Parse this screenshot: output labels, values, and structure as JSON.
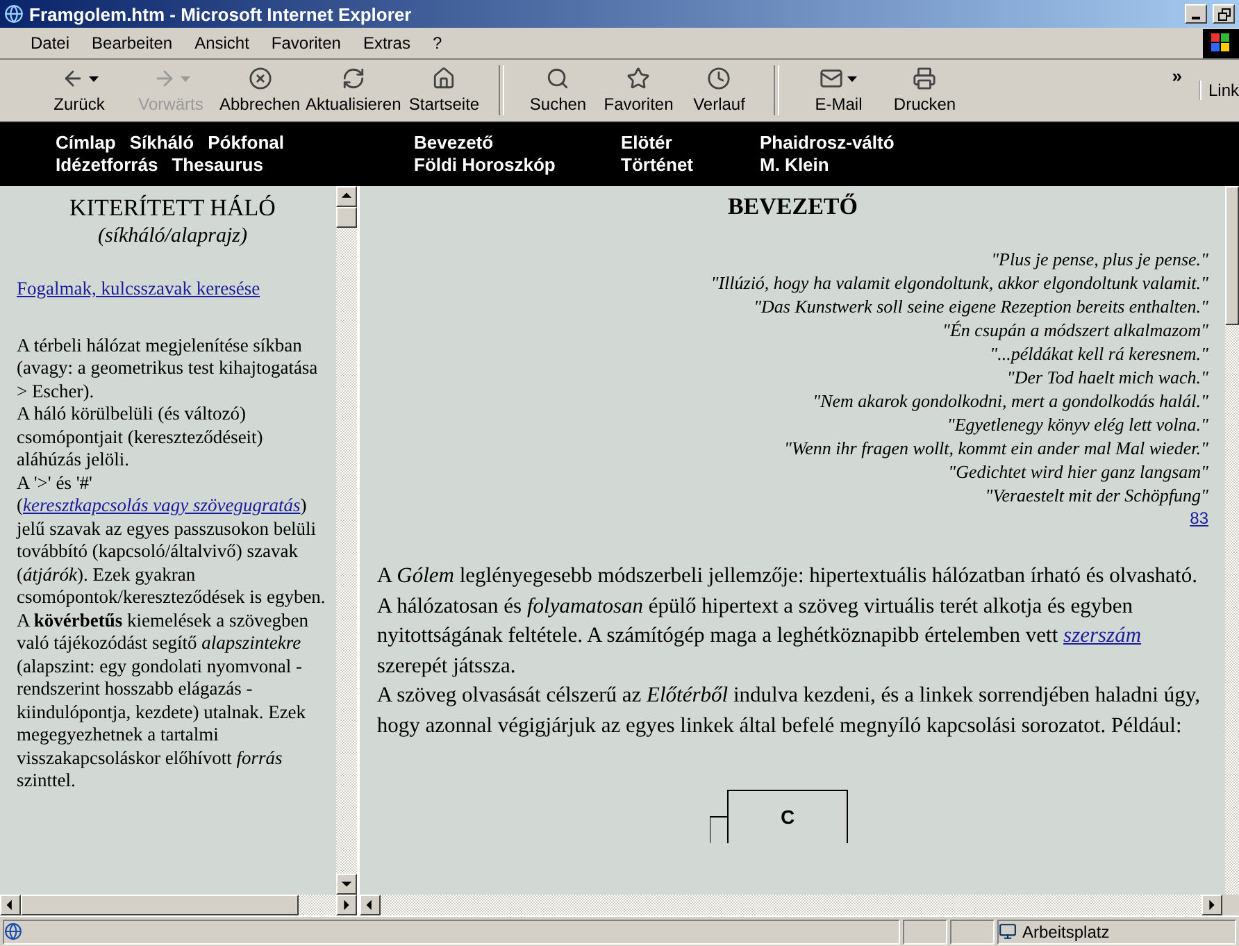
{
  "window": {
    "title": "Framgolem.htm - Microsoft Internet Explorer"
  },
  "menu": [
    "Datei",
    "Bearbeiten",
    "Ansicht",
    "Favoriten",
    "Extras",
    "?"
  ],
  "toolbar": [
    {
      "label": "Zurück",
      "kind": "back",
      "dropdown": true,
      "disabled": false
    },
    {
      "label": "Vorwärts",
      "kind": "forward",
      "dropdown": true,
      "disabled": true
    },
    {
      "label": "Abbrechen",
      "kind": "stop",
      "dropdown": false,
      "disabled": false
    },
    {
      "label": "Aktualisieren",
      "kind": "refresh",
      "dropdown": false,
      "disabled": false
    },
    {
      "label": "Startseite",
      "kind": "home",
      "dropdown": false,
      "disabled": false,
      "separator_after": true
    },
    {
      "label": "Suchen",
      "kind": "search",
      "dropdown": false,
      "disabled": false
    },
    {
      "label": "Favoriten",
      "kind": "favorites",
      "dropdown": false,
      "disabled": false
    },
    {
      "label": "Verlauf",
      "kind": "history",
      "dropdown": false,
      "disabled": false,
      "separator_after": true
    },
    {
      "label": "E-Mail",
      "kind": "mail",
      "dropdown": true,
      "disabled": false
    },
    {
      "label": "Drucken",
      "kind": "print",
      "dropdown": false,
      "disabled": false
    }
  ],
  "toolbar_more": "»",
  "links_label": "Link",
  "nav": [
    {
      "rows": [
        [
          "Címlap",
          "Síkháló",
          "Pókfonal"
        ],
        [
          "Idézetforrás",
          "Thesaurus"
        ]
      ]
    },
    {
      "rows": [
        [
          "Bevezető"
        ],
        [
          "Földi Horoszkóp"
        ]
      ]
    },
    {
      "rows": [
        [
          "Elötér"
        ],
        [
          "Történet"
        ]
      ]
    },
    {
      "rows": [
        [
          "Phaidrosz-váltó"
        ],
        [
          "M. Klein"
        ]
      ]
    }
  ],
  "left_frame": {
    "title": "KITERÍTETT HÁLÓ",
    "subtitle": "(síkháló/alaprajz)",
    "search_link": "Fogalmak, kulcsszavak keresése",
    "paragraphs": [
      [
        {
          "kind": "text",
          "text": "A térbeli hálózat megjelenítése síkban (avagy: a geometrikus test kihajtogatása > Escher)."
        }
      ],
      [
        {
          "kind": "text",
          "text": "A háló körülbelüli (és változó) csomópontjait (kereszteződéseit) aláhúzás jelöli."
        }
      ],
      [
        {
          "kind": "text",
          "text": "A '>' és '#' ("
        },
        {
          "kind": "link",
          "text": "keresztkapcsolás vagy szövegugratás"
        },
        {
          "kind": "text",
          "text": ") jelű szavak az egyes passzusokon belüli továbbító (kapcsoló/általvivő) szavak (*átjárók*). Ezek gyakran csomópontok/kereszteződések is egyben."
        }
      ],
      [
        {
          "kind": "text",
          "text": "A **kövérbetűs** kiemelések a szövegben való tájékozódást segítő *alapszintekre* (alapszint: egy gondolati nyomvonal - rendszerint hosszabb elágazás - kiindulópontja, kezdete) utalnak. Ezek megegyezhetnek a tartalmi visszakapcsoláskor előhívott *forrás* szinttel."
        }
      ]
    ]
  },
  "main_frame": {
    "heading": "BEVEZETŐ",
    "quotes": [
      "\"Plus je pense, plus je pense.\"",
      "\"Illúzió, hogy ha valamit elgondoltunk, akkor elgondoltunk valamit.\"",
      "\"Das Kunstwerk soll seine eigene Rezeption bereits enthalten.\"",
      "\"Én csupán a módszert alkalmazom\"",
      "\"...példákat kell rá keresnem.\"",
      "\"Der Tod haelt mich wach.\"",
      "\"Nem akarok gondolkodni, mert a gondolkodás halál.\"",
      "\"Egyetlenegy könyv elég lett volna.\"",
      "\"Wenn ihr fragen wollt, kommt ein ander mal Mal wieder.\"",
      "\"Gedichtet wird hier ganz langsam\"",
      "\"Veraestelt mit der Schöpfung\""
    ],
    "quote_link": "83",
    "paragraphs": [
      [
        {
          "kind": "text",
          "text": "A *Gólem* leglényegesebb módszerbeli jellemzője: hipertextuális hálózatban írható és olvasható. A hálózatosan és *folyamatosan* épülő hipertext a szöveg virtuális terét alkotja és egyben nyitottságának feltétele. A számítógép maga a leghétköznapibb értelemben vett "
        },
        {
          "kind": "link",
          "text": "szerszám"
        },
        {
          "kind": "text",
          "text": " szerepét játssza."
        }
      ],
      [
        {
          "kind": "text",
          "text": "A szöveg olvasását célszerű az *Előtérből* indulva kezdeni, és a linkek sorrendjében haladni úgy, hogy azonnal végigjárjuk az egyes linkek által befelé megnyíló kapcsolási sorozatot. Például:"
        }
      ]
    ],
    "diagram_box": "C"
  },
  "status_bar": {
    "zone": "Arbeitsplatz"
  }
}
